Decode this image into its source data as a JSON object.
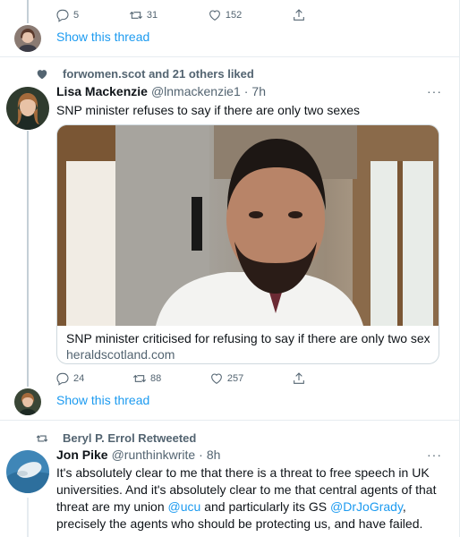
{
  "tweet_top": {
    "reply_count": "5",
    "retweet_count": "31",
    "like_count": "152",
    "show_thread": "Show this thread"
  },
  "tweet_main": {
    "social_context": "forwomen.scot and 21 others liked",
    "name": "Lisa Mackenzie",
    "handle": "@lnmackenzie1",
    "separator": "·",
    "time": "7h",
    "text": "SNP minister refuses to say if there are only two sexes",
    "card_title": "SNP minister criticised for refusing to say if there are only two sexes",
    "card_domain": "heraldscotland.com",
    "reply_count": "24",
    "retweet_count": "88",
    "like_count": "257",
    "show_thread": "Show this thread",
    "more": "···"
  },
  "tweet_bottom": {
    "social_context": "Beryl P. Errol Retweeted",
    "name": "Jon Pike",
    "handle": "@runthinkwrite",
    "separator": "·",
    "time": "8h",
    "text_1": "It's absolutely clear to me that there is a threat to free speech in UK universities.  And it's absolutely clear to me that central agents of that threat are my union ",
    "mention_1": "@ucu",
    "text_2": " and particularly its GS ",
    "mention_2": "@DrJoGrady",
    "text_3": ", precisely the agents who should be protecting us, and have failed.",
    "more": "···"
  },
  "colors": {
    "accent": "#1d9bf0",
    "muted": "#536471",
    "border": "#cfd9de"
  }
}
